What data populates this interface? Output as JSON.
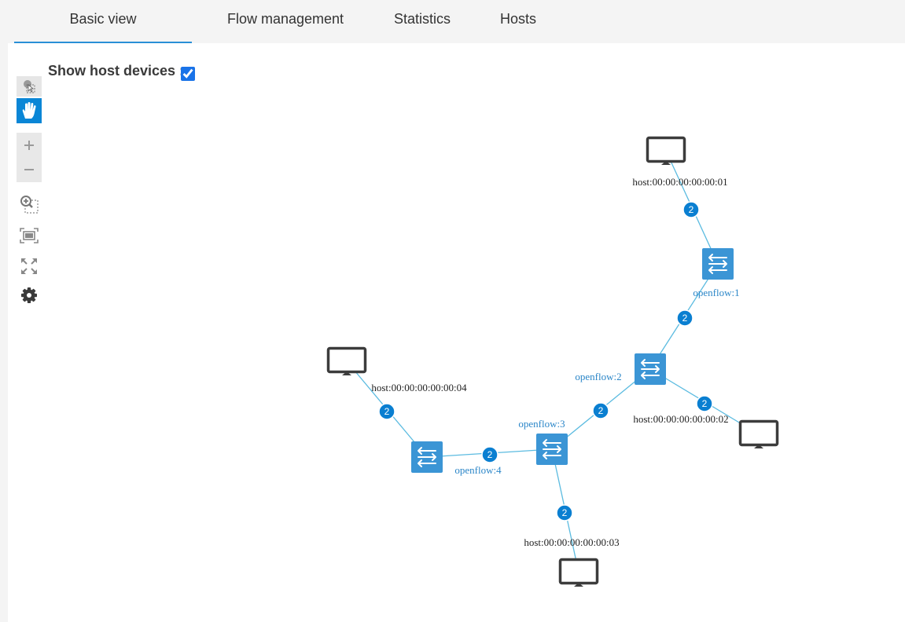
{
  "tabs": [
    {
      "label": "Basic view",
      "active": true
    },
    {
      "label": "Flow management",
      "active": false
    },
    {
      "label": "Statistics",
      "active": false
    },
    {
      "label": "Hosts",
      "active": false
    }
  ],
  "options": {
    "show_host_label": "Show host devices :",
    "show_host_checked": true
  },
  "toolbar": [
    {
      "name": "select-icon",
      "tooltip": "select"
    },
    {
      "name": "pan-hand-icon",
      "tooltip": "pan",
      "active": true
    },
    {
      "name": "zoom-in-icon"
    },
    {
      "name": "zoom-out-icon"
    },
    {
      "name": "zoom-selection-icon"
    },
    {
      "name": "fit-view-icon"
    },
    {
      "name": "fullscreen-icon"
    },
    {
      "name": "gear-icon"
    }
  ],
  "colors": {
    "accent": "#2a8fd6",
    "switch": "#3b95d5",
    "link": "#5bbbe0",
    "badge": "#0a7fd1",
    "host_icon": "#3c3c3c"
  },
  "topology": {
    "switches": [
      {
        "id": "s1",
        "label": "openflow:1"
      },
      {
        "id": "s2",
        "label": "openflow:2"
      },
      {
        "id": "s3",
        "label": "openflow:3"
      },
      {
        "id": "s4",
        "label": "openflow:4"
      }
    ],
    "hosts": [
      {
        "id": "h1",
        "label": "host:00:00:00:00:00:01"
      },
      {
        "id": "h2",
        "label": "host:00:00:00:00:00:02"
      },
      {
        "id": "h3",
        "label": "host:00:00:00:00:00:03"
      },
      {
        "id": "h4",
        "label": "host:00:00:00:00:00:04"
      }
    ],
    "links": [
      {
        "from": "h1",
        "to": "s1",
        "badge": "2"
      },
      {
        "from": "s1",
        "to": "s2",
        "badge": "2"
      },
      {
        "from": "s2",
        "to": "h2",
        "badge": "2"
      },
      {
        "from": "s2",
        "to": "s3",
        "badge": "2"
      },
      {
        "from": "s3",
        "to": "s4",
        "badge": "2"
      },
      {
        "from": "s3",
        "to": "h3",
        "badge": "2"
      },
      {
        "from": "h4",
        "to": "s4",
        "badge": "2"
      }
    ]
  }
}
